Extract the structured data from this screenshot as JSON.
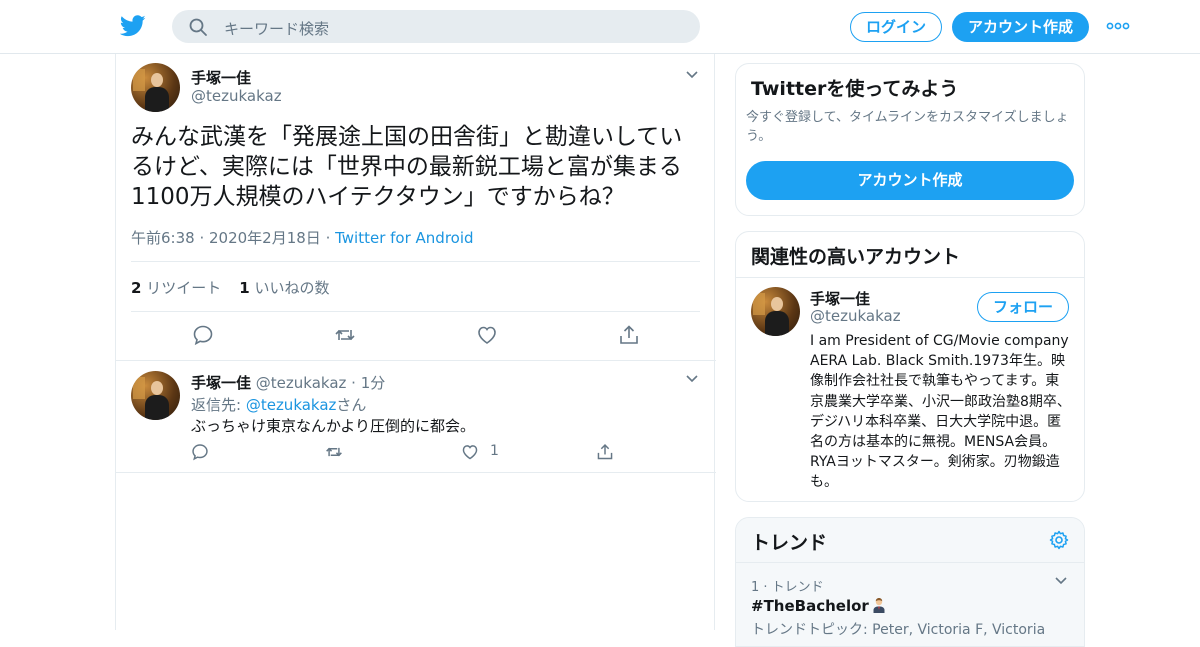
{
  "header": {
    "search_placeholder": "キーワード検索",
    "login_label": "ログイン",
    "signup_label": "アカウント作成"
  },
  "tweet": {
    "author_name": "手塚一佳",
    "author_handle": "@tezukakaz",
    "text": "みんな武漢を「発展途上国の田舎街」と勘違いしているけど、実際には「世界中の最新鋭工場と富が集まる1100万人規模のハイテクタウン」ですからね？",
    "timestamp": "午前6:38 · 2020年2月18日",
    "meta_sep": " · ",
    "source": "Twitter for Android",
    "retweet_count": "2",
    "retweet_label": "リツイート",
    "like_count": "1",
    "like_label": "いいねの数"
  },
  "reply": {
    "author_name": "手塚一佳",
    "author_handle": "@tezukakaz",
    "time": " · 1分",
    "reply_prefix": "返信先: ",
    "reply_to": "@tezukakaz",
    "reply_suffix": "さん",
    "text": "ぶっちゃけ東京なんかより圧倒的に都会。",
    "like_count": "1"
  },
  "sidebar": {
    "signup_card": {
      "title": "Twitterを使ってみよう",
      "description": "今すぐ登録して、タイムラインをカスタマイズしましょう。",
      "button": "アカウント作成"
    },
    "related_card": {
      "title": "関連性の高いアカウント",
      "name": "手塚一佳",
      "handle": "@tezukakaz",
      "follow_label": "フォロー",
      "bio": "I am President of CG/Movie company AERA Lab. Black Smith.1973年生。映像制作会社社長で執筆もやってます。東京農業大学卒業、小沢一郎政治塾8期卒、デジハリ本科卒業、日大大学院中退。匿名の方は基本的に無視。MENSA会員。RYAヨットマスター。剣術家。刃物鍛造も。"
    },
    "trends": {
      "title": "トレンド",
      "rank": "1 · トレンド",
      "hashtag": "#TheBachelor",
      "topic": "トレンドトピック: Peter, Victoria F, Victoria"
    }
  },
  "colors": {
    "accent": "#1da1f2",
    "link": "#1b95e0",
    "muted": "#657786",
    "divider": "#e6ecf0"
  },
  "icons": [
    "twitter-logo-icon",
    "search-icon",
    "more-icon",
    "chevron-down-icon",
    "reply-icon",
    "retweet-icon",
    "like-icon",
    "share-icon",
    "gear-icon",
    "man-emoji-icon"
  ]
}
